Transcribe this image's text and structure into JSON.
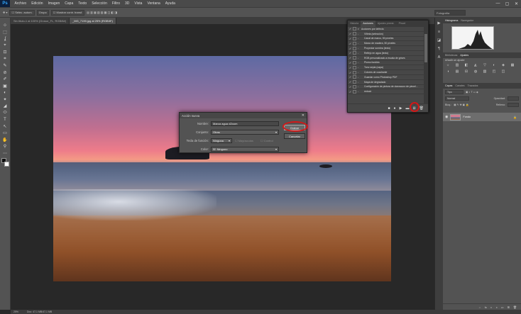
{
  "app": {
    "logo": "Ps"
  },
  "menubar": {
    "items": [
      "Archivo",
      "Edición",
      "Imagen",
      "Capa",
      "Texto",
      "Selección",
      "Filtro",
      "3D",
      "Vista",
      "Ventana",
      "Ayuda"
    ],
    "window_controls": [
      "—",
      "▢",
      "✕"
    ]
  },
  "options_bar": {
    "item1": "Selec. autom.",
    "item2": "Grupo",
    "item3": "Mostrar contr. transf.",
    "workspace": "Fotografía"
  },
  "tabs": [
    {
      "label": "Sin título-1 al 100% (Grosor_FL, RGB/8#)"
    },
    {
      "label": "_MG_7190.jpg al 25% (RGB/8*)"
    }
  ],
  "tools": [
    "⊹",
    "⬚",
    "ʆ",
    "⌖",
    "⊡",
    "⌗",
    "✎",
    "⊘",
    "✐",
    "▣",
    "◐",
    "✦",
    "◢",
    "⬭",
    "T",
    "↖",
    "▭",
    "✋",
    "⚲",
    "⋯"
  ],
  "statusbar": {
    "zoom": "25%",
    "doc": "Doc: 47,1 MB/47,1 MB"
  },
  "actions_panel": {
    "tabs": [
      "Historia",
      "Acciones",
      "Ajustes preest.",
      "Pincel"
    ],
    "active_tab": "Acciones",
    "items": [
      {
        "label": "Acciones por defecto",
        "folder": true,
        "checked": true
      },
      {
        "label": "Viñeta (selección)",
        "checked": true
      },
      {
        "label": "Canal de marco, 50 píxeles",
        "checked": true
      },
      {
        "label": "Marco de madera, 50 píxeles",
        "checked": true
      },
      {
        "label": "Proyectar sombra (texto)",
        "checked": true
      },
      {
        "label": "Reflejo en agua (texto)",
        "checked": true
      },
      {
        "label": "RGB personalizado a escala de grises",
        "checked": true
      },
      {
        "label": "Plomo fundido",
        "checked": true
      },
      {
        "label": "Tono sepia (capa)",
        "checked": true
      },
      {
        "label": "Colores de cuadrante",
        "checked": true
      },
      {
        "label": "Guardar como Photoshop PDF",
        "checked": true
      },
      {
        "label": "Mapa de degradado",
        "checked": true
      },
      {
        "label": "Configuración de pintura de claroscuro de pincel...",
        "checked": true
      },
      {
        "label": "reducir",
        "checked": true
      }
    ],
    "footer_buttons": [
      "■",
      "●",
      "▶",
      "▬",
      "⊞",
      "🗑"
    ]
  },
  "dock": [
    "▶",
    "≡",
    "◪",
    "¶",
    "A"
  ],
  "right_panel": {
    "histogram_tabs": [
      "Histograma",
      "Navegador"
    ],
    "adjust_tabs": [
      "Bibliotecas",
      "Ajustes"
    ],
    "adjust_title": "Añadir un ajuste",
    "adjust_icons": [
      "☼",
      "▥",
      "◧",
      "◭",
      "▽",
      "◐",
      "◈",
      "▦",
      "◑",
      "▤",
      "⊟",
      "◍",
      "▧",
      "◰",
      "◫"
    ],
    "layers_tabs": [
      "Capas",
      "Canales",
      "Trazados"
    ],
    "layer_kind": "Tipo",
    "blend": "Normal",
    "opacity_label": "Opacidad:",
    "lock_label": "Bloq.:",
    "fill_label": "Relleno:",
    "layer_name": "Fondo",
    "footer_icons": [
      "⇔",
      "fx",
      "◐",
      "◑",
      "▭",
      "⊞",
      "🗑"
    ]
  },
  "dialog": {
    "title": "Acción nueva",
    "name_label": "Nombre:",
    "name_value": "Marca agua d2oom",
    "set_label": "Conjunto:",
    "set_value": "Otras",
    "fkey_label": "Tecla de función:",
    "fkey_value": "Ninguna",
    "shift_label": "Mayúsculas",
    "control_label": "Control",
    "color_label": "Color:",
    "color_value": "Ninguno",
    "record_button": "Grabar",
    "cancel_button": "Cancelar"
  },
  "colors": {
    "highlight": "#d31818",
    "panel": "#535353",
    "workspace": "#282828"
  }
}
